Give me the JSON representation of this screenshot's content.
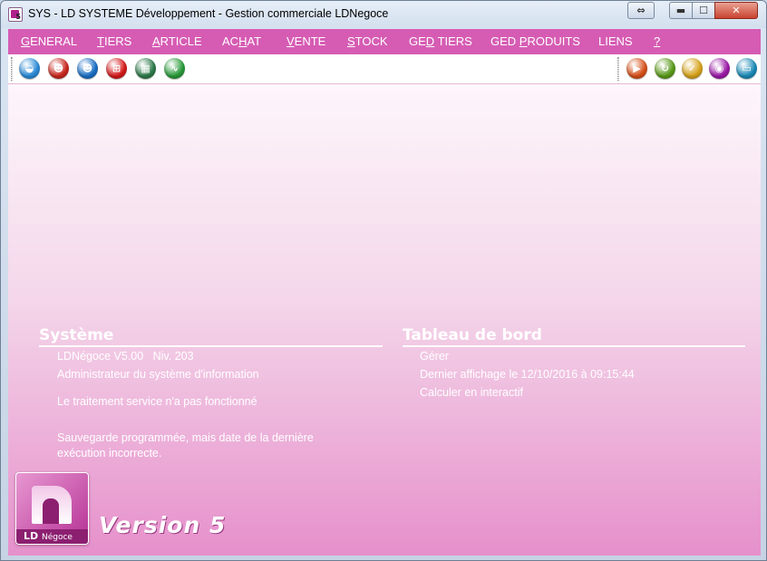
{
  "window": {
    "title": "SYS - LD SYSTEME Développement - Gestion commerciale LDNegoce",
    "icon_label": "5",
    "buttons": {
      "resize": "⇔",
      "minimize": "▬",
      "maximize": "☐",
      "close": "✕"
    }
  },
  "menu": [
    {
      "key": "general",
      "pre": "",
      "ul": "G",
      "post": "ENERAL"
    },
    {
      "key": "tiers",
      "pre": "",
      "ul": "T",
      "post": "IERS"
    },
    {
      "key": "article",
      "pre": "",
      "ul": "A",
      "post": "RTICLE"
    },
    {
      "key": "achat",
      "pre": "AC",
      "ul": "H",
      "post": "AT"
    },
    {
      "key": "vente",
      "pre": "",
      "ul": "V",
      "post": "ENTE"
    },
    {
      "key": "stock",
      "pre": "",
      "ul": "S",
      "post": "TOCK"
    },
    {
      "key": "ged-tiers",
      "pre": "GE",
      "ul": "D",
      "post": " TIERS"
    },
    {
      "key": "ged-produits",
      "pre": "GED ",
      "ul": "P",
      "post": "RODUITS"
    },
    {
      "key": "liens",
      "pre": "",
      "ul": "",
      "post": "LIENS"
    },
    {
      "key": "help",
      "pre": "",
      "ul": "?",
      "post": ""
    }
  ],
  "toolbar_left": [
    {
      "name": "basket-icon",
      "glyph": "◒",
      "color": "#2a8ad6"
    },
    {
      "name": "user-red-icon",
      "glyph": "☻",
      "color": "#c8281e"
    },
    {
      "name": "user-blue-icon",
      "glyph": "☻",
      "color": "#1a6fc4"
    },
    {
      "name": "cart-icon",
      "glyph": "⊞",
      "color": "#d41a1a"
    },
    {
      "name": "calculator-icon",
      "glyph": "▦",
      "color": "#2e7a4a"
    },
    {
      "name": "stethoscope-icon",
      "glyph": "∿",
      "color": "#2a9a3a"
    }
  ],
  "toolbar_right": [
    {
      "name": "play-icon",
      "glyph": "▶",
      "color": "#d6501a"
    },
    {
      "name": "refresh-icon",
      "glyph": "↻",
      "color": "#5a9a1a"
    },
    {
      "name": "check-icon",
      "glyph": "✓",
      "color": "#d6a21a"
    },
    {
      "name": "camera-icon",
      "glyph": "◉",
      "color": "#9a1aa6"
    },
    {
      "name": "remote-desktop-icon",
      "glyph": "▭",
      "color": "#1a8ab6"
    }
  ],
  "systeme": {
    "title": "Système",
    "version": "LDNégoce V5.00",
    "niveau": "Niv. 203",
    "admin": "Administrateur du système d'information",
    "service_msg": "Le traitement service n'a pas fonctionné",
    "backup_line1": "Sauvegarde programmée, mais date de la dernière",
    "backup_line2": "exécution incorrecte."
  },
  "tableau": {
    "title": "Tableau de bord",
    "gerer": "Gérer",
    "last_display": "Dernier affichage le 12/10/2016 à 09:15:44",
    "calculer": "Calculer en interactif"
  },
  "logo": {
    "brand": "LD",
    "brand_suffix": "Négoce",
    "version": "Version 5"
  },
  "colors": {
    "menu_bg": "#d65cb3",
    "accent": "#b53094"
  }
}
